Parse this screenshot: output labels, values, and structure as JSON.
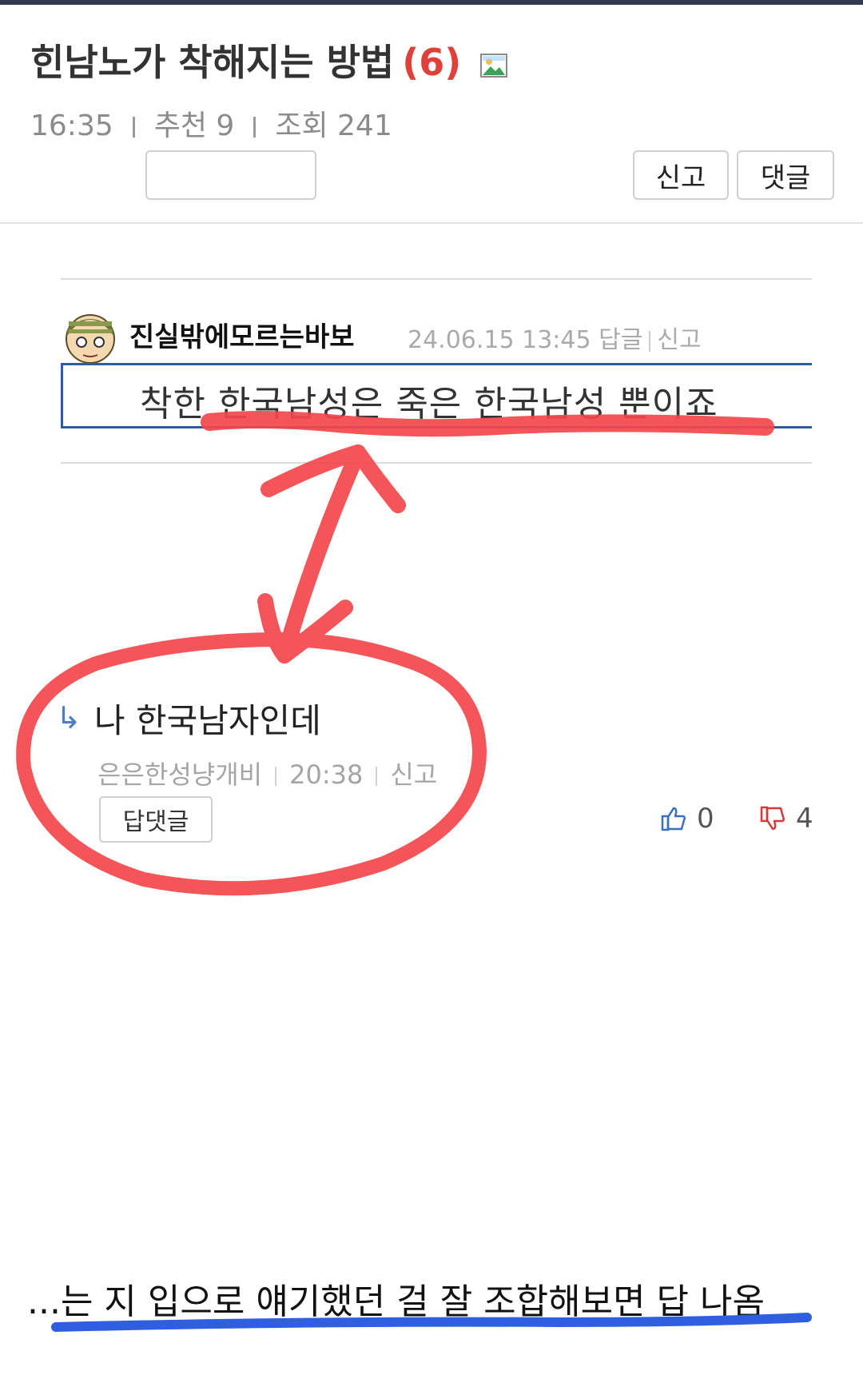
{
  "post": {
    "title": "힌남노가 착해지는 방법",
    "comment_count": "(6)",
    "time": "16:35",
    "recommend": "추천 9",
    "views": "조회 241",
    "hidden_button_label": "",
    "report_label": "신고",
    "reply_label": "댓글"
  },
  "quoted_comment": {
    "author": "진실밖에모르는바보",
    "datetime": "24.06.15 13:45",
    "reply_link": "답글",
    "report_link": "신고",
    "text": "착한 한국남성은 죽은 한국남성 뿐이죠"
  },
  "reply_comment": {
    "text": "나 한국남자인데",
    "author": "은은한성냥개비",
    "time": "20:38",
    "report_link": "신고",
    "reply_button": "답댓글",
    "upvotes": "0",
    "downvotes": "4"
  },
  "caption": "...는 지 입으로 얘기했던 걸 잘 조합해보면 답 나옴",
  "colors": {
    "annotation_red": "#f2474a",
    "annotation_blue": "#2f5fe0",
    "quote_border": "#2b5da0",
    "title_count": "#e0403a"
  },
  "icons": [
    "image-icon",
    "avatar-icon",
    "reply-arrow-icon",
    "thumbs-up-icon",
    "thumbs-down-icon"
  ]
}
